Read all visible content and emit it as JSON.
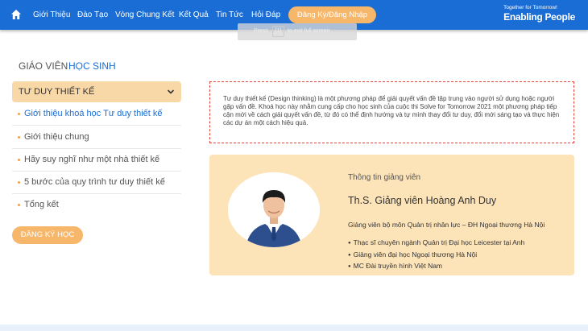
{
  "nav": {
    "home_icon": "home-icon",
    "items": [
      "Giới Thiệu",
      "Đào Tạo",
      "Vòng Chung Kết",
      "Kết Quả",
      "Tin Tức",
      "Hỏi Đáp"
    ],
    "cta": "Đăng Ký/Đăng Nhập",
    "brand_tagline": "Together for Tomorrow!",
    "brand_name": "Enabling People",
    "color": "#1a6dd4",
    "accent": "#f7b76b"
  },
  "zoom_hint": {
    "before": "Press",
    "key": "[1]",
    "after": "to exit full screen"
  },
  "tabs": [
    "GIÁO VIÊN",
    "HỌC SINH"
  ],
  "sidebar": {
    "section_title": "TƯ DUY THIẾT KẾ",
    "items": [
      "Giới thiệu khoá học Tư duy thiết kế",
      "Giới thiệu chung",
      "Hãy suy nghĩ như một nhà thiết kế",
      "5 bước của quy trình tư duy thiết kế",
      "Tổng kết"
    ],
    "register_button": "ĐĂNG KÝ HỌC"
  },
  "intro": {
    "text": "Tư duy thiết kế (Design thinking) là một phương pháp để giải quyết vấn đề tập trung vào người sử dụng hoặc người gặp vấn đề. Khoá học này nhằm cung cấp cho học sinh của cuộc thi Solve for Tomorrow 2021 một phương pháp tiếp cận mới về cách giải quyết vấn đề, từ đó có thể định hướng và tự mình thay đổi tư duy, đổi mới sáng tạo và thực hiện các dự án một cách hiệu quả."
  },
  "teacher": {
    "caption": "Thông tin giảng viên",
    "name": "Th.S. Giảng viên Hoàng Anh Duy",
    "role": "Giảng viên bộ môn Quản trị nhân lực – ĐH Ngoại thương Hà Nội",
    "credentials": [
      "Thạc sĩ chuyên ngành Quản trị Đại học Leicester tại Anh",
      "Giảng viên đại học Ngoại thương Hà Nội",
      "MC Đài truyền hình Việt Nam"
    ]
  }
}
